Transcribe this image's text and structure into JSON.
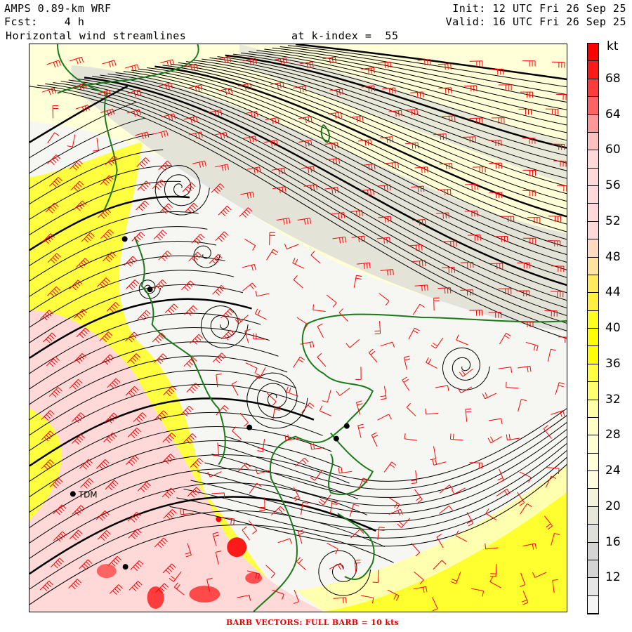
{
  "header": {
    "model": "AMPS 0.89-km WRF",
    "forecast": "Fcst:    4 h",
    "field": "Horizontal wind streamlines",
    "level": "at k-index =  55",
    "init": "Init: 12 UTC Fri 26 Sep 25",
    "valid": "Valid: 16 UTC Fri 26 Sep 25"
  },
  "colorbar": {
    "unit": "kt",
    "labels": [
      "68",
      "64",
      "60",
      "56",
      "52",
      "48",
      "44",
      "40",
      "36",
      "32",
      "28",
      "24",
      "20",
      "16",
      "12"
    ],
    "min": 8,
    "max": 72,
    "step": 2,
    "colors": [
      "#ff0000",
      "#ff1a1a",
      "#ff3c3c",
      "#ff6464",
      "#ff9898",
      "#ffc0c0",
      "#ffd8d8",
      "#ffd8d8",
      "#ffdada",
      "#ffdada",
      "#ffd8d8",
      "#ffdcc0",
      "#ffe4a0",
      "#ffea60",
      "#fff040",
      "#ffff20",
      "#ffff00",
      "#ffff00",
      "#ffff40",
      "#ffff70",
      "#ffffa8",
      "#ffffc8",
      "#ffffd4",
      "#ffffdc",
      "#fffde0",
      "#f4f4dc",
      "#e8e8d8",
      "#e0e0da",
      "#d4d4d4",
      "#d4d4d4",
      "#e6e6e6",
      "#f4f4f4"
    ]
  },
  "stations": [
    {
      "label": "TDM"
    }
  ],
  "footer": "BARB VECTORS:  FULL BARB = 10 kts",
  "colors": {
    "coast": "#1a7a1a",
    "barb": "#ff0000",
    "stream": "#000000"
  }
}
